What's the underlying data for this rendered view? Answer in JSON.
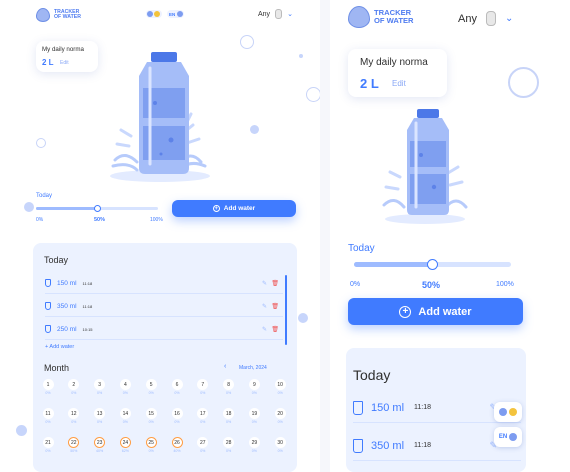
{
  "header": {
    "logo_line1": "TRACKER",
    "logo_line2": "OF WATER",
    "user_name": "Any",
    "language": "EN",
    "logo_icon": "water-drop-logo-icon",
    "avatar_icon": "avatar-icon",
    "chevron_icon": "chevron-down-icon"
  },
  "norma": {
    "title": "My daily norma",
    "value": "2 L",
    "edit_label": "Edit"
  },
  "progress": {
    "label": "Today",
    "percent_value": 50,
    "min_label": "0%",
    "mid_label": "50%",
    "max_label": "100%"
  },
  "add_water_button": "Add water",
  "today": {
    "title": "Today",
    "entries": [
      {
        "amount": "150 ml",
        "time": "11:18"
      },
      {
        "amount": "350 ml",
        "time": "11:18"
      },
      {
        "amount": "250 ml",
        "time": "10:15"
      }
    ],
    "add_link": "+ Add water"
  },
  "month": {
    "title": "Month",
    "period": "March, 2024",
    "prev_icon": "chevron-left-icon",
    "days": [
      {
        "d": "1",
        "p": "0%"
      },
      {
        "d": "2",
        "p": "0%"
      },
      {
        "d": "3",
        "p": "0%"
      },
      {
        "d": "4",
        "p": "0%"
      },
      {
        "d": "5",
        "p": "0%"
      },
      {
        "d": "6",
        "p": "0%"
      },
      {
        "d": "7",
        "p": "0%"
      },
      {
        "d": "8",
        "p": "0%"
      },
      {
        "d": "9",
        "p": "0%"
      },
      {
        "d": "10",
        "p": "0%"
      },
      {
        "d": "11",
        "p": "0%"
      },
      {
        "d": "12",
        "p": "0%"
      },
      {
        "d": "13",
        "p": "0%"
      },
      {
        "d": "14",
        "p": "0%"
      },
      {
        "d": "15",
        "p": "0%"
      },
      {
        "d": "16",
        "p": "0%"
      },
      {
        "d": "17",
        "p": "0%"
      },
      {
        "d": "18",
        "p": "0%"
      },
      {
        "d": "19",
        "p": "0%"
      },
      {
        "d": "20",
        "p": "0%"
      },
      {
        "d": "21",
        "p": "0%"
      },
      {
        "d": "22",
        "p": "50%"
      },
      {
        "d": "23",
        "p": "40%"
      },
      {
        "d": "24",
        "p": "62%"
      },
      {
        "d": "25",
        "p": "0%"
      },
      {
        "d": "26",
        "p": "40%"
      },
      {
        "d": "27",
        "p": "0%"
      },
      {
        "d": "28",
        "p": "0%"
      },
      {
        "d": "29",
        "p": "0%"
      },
      {
        "d": "30",
        "p": "0%"
      }
    ],
    "highlighted_days": [
      "22",
      "23",
      "24",
      "25",
      "26"
    ]
  },
  "mobile": {
    "today_title": "Today",
    "entries": [
      {
        "amount": "150 ml",
        "time": "11:18"
      },
      {
        "amount": "350 ml",
        "time": "11:18"
      }
    ],
    "language": "EN"
  },
  "colors": {
    "accent": "#407bff",
    "light_blue": "#9ebbff",
    "pale_blue": "#d7e3ff",
    "card_bg": "#ecf2ff",
    "delete": "#ef5050",
    "highlight": "#ff9d43"
  }
}
